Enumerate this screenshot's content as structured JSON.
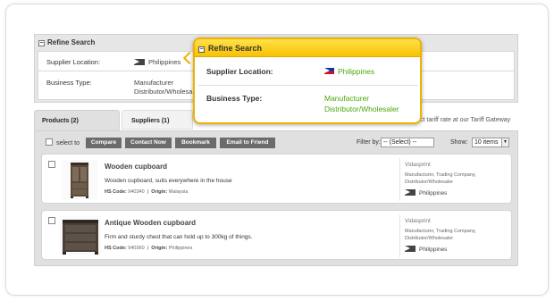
{
  "refine": {
    "title": "Refine Search",
    "supplier_location_label": "Supplier Location:",
    "supplier_location_value": "Philippines",
    "business_type_label": "Business Type:",
    "business_type_line1": "Manufacturer",
    "business_type_line2": "Distributor/Wholesaler"
  },
  "popup": {
    "title": "Refine Search",
    "supplier_location_label": "Supplier Location:",
    "supplier_location_value": "Philippines",
    "business_type_label": "Business Type:",
    "business_type_line1": "Manufacturer",
    "business_type_line2": "Distributor/Wholesaler",
    "accent_color": "#f7c200",
    "value_color": "#4aa80a"
  },
  "tabs": {
    "products": "Products (2)",
    "suppliers": "Suppliers (1)"
  },
  "tariff_text": "ct tariff rate at our Tariff Gateway",
  "toolbar": {
    "select_to": "select to",
    "compare": "Compare",
    "contact_now": "Contact Now",
    "bookmark": "Bookmark",
    "email_to_friend": "Email to Friend",
    "filter_by": "Filter by:",
    "filter_value": "-- (Select) --",
    "show": "Show:",
    "show_value": "10 items"
  },
  "products": [
    {
      "title": "Wooden cupboard",
      "description": "Wooden cupboard, suits everywhere in the house",
      "hs_label": "HS Code:",
      "hs_code": "940340",
      "origin_label": "Origin:",
      "origin": "Malaysia",
      "supplier": "Vidasprint",
      "supplier_type_line1": "Manufacturer, Trading Company,",
      "supplier_type_line2": "Distributor/Wholesaler",
      "country": "Philippines"
    },
    {
      "title": "Antique Wooden cupboard",
      "description": "Firm and sturdy chest that can hold up to 300kg of things.",
      "hs_label": "HS Code:",
      "hs_code": "940360",
      "origin_label": "Origin:",
      "origin": "Philippines",
      "supplier": "Vidasprint",
      "supplier_type_line1": "Manufacturer, Trading Company,",
      "supplier_type_line2": "Distributor/Wholesaler",
      "country": "Philippines"
    }
  ]
}
